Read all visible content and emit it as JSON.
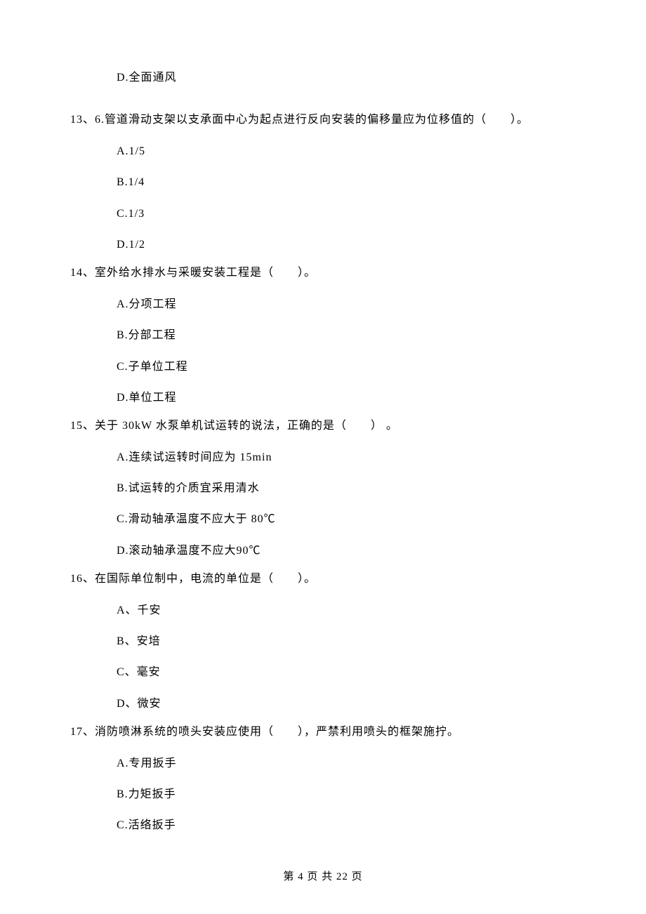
{
  "orphan_option": "D.全面通风",
  "questions": [
    {
      "stem": "13、6.管道滑动支架以支承面中心为起点进行反向安装的偏移量应为位移值的（　　）。",
      "options": [
        "A.1/5",
        "B.1/4",
        "C.1/3",
        "D.1/2"
      ]
    },
    {
      "stem": "14、室外给水排水与采暖安装工程是（　　）。",
      "options": [
        "A.分项工程",
        "B.分部工程",
        "C.子单位工程",
        "D.单位工程"
      ]
    },
    {
      "stem": "15、关于 30kW 水泵单机试运转的说法，正确的是（　　） 。",
      "options": [
        "A.连续试运转时间应为 15min",
        "B.试运转的介质宜采用清水",
        "C.滑动轴承温度不应大于 80℃",
        "D.滚动轴承温度不应大90℃"
      ]
    },
    {
      "stem": "16、在国际单位制中，电流的单位是（　　）。",
      "options": [
        "A、千安",
        "B、安培",
        "C、毫安",
        "D、微安"
      ]
    },
    {
      "stem": "17、消防喷淋系统的喷头安装应使用（　　），严禁利用喷头的框架施拧。",
      "options": [
        "A.专用扳手",
        "B.力矩扳手",
        "C.活络扳手"
      ]
    }
  ],
  "footer": "第 4 页 共 22 页"
}
